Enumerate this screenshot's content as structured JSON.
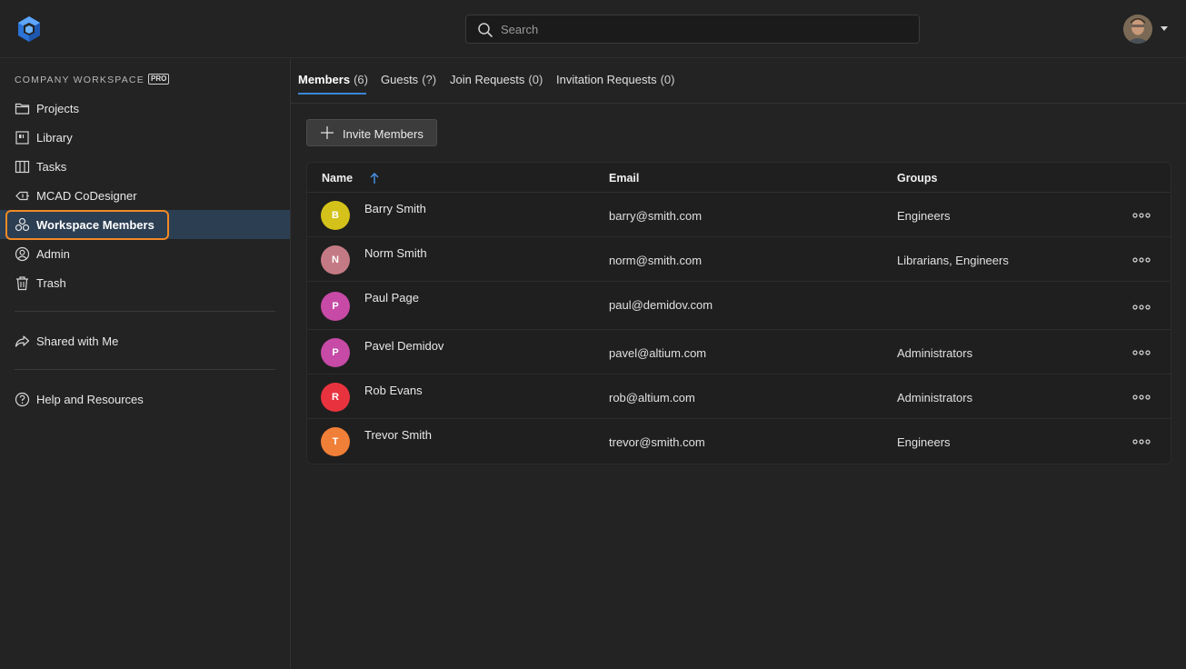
{
  "search": {
    "placeholder": "Search"
  },
  "sidebar": {
    "workspace_label": "COMPANY WORKSPACE",
    "badge": "PRO",
    "items": [
      {
        "label": "Projects",
        "icon": "folder-icon"
      },
      {
        "label": "Library",
        "icon": "library-icon"
      },
      {
        "label": "Tasks",
        "icon": "tasks-icon"
      },
      {
        "label": "MCAD CoDesigner",
        "icon": "mcad-icon"
      },
      {
        "label": "Workspace Members",
        "icon": "members-icon",
        "active": true
      },
      {
        "label": "Admin",
        "icon": "admin-icon"
      },
      {
        "label": "Trash",
        "icon": "trash-icon"
      }
    ],
    "shared": {
      "label": "Shared with Me",
      "icon": "share-icon"
    },
    "help": {
      "label": "Help and Resources",
      "icon": "help-icon"
    }
  },
  "tabs": [
    {
      "label": "Members",
      "count": "(6)",
      "active": true
    },
    {
      "label": "Guests",
      "count": "(?)"
    },
    {
      "label": "Join Requests",
      "count": "(0)"
    },
    {
      "label": "Invitation Requests",
      "count": "(0)"
    }
  ],
  "invite_button": {
    "label": "Invite Members"
  },
  "table": {
    "columns": {
      "name": "Name",
      "email": "Email",
      "groups": "Groups"
    },
    "rows": [
      {
        "initial": "B",
        "color": "#d4c21a",
        "name": "Barry Smith",
        "email": "barry@smith.com",
        "groups": "Engineers"
      },
      {
        "initial": "N",
        "color": "#c47a84",
        "name": "Norm Smith",
        "email": "norm@smith.com",
        "groups": "Librarians, Engineers"
      },
      {
        "initial": "P",
        "color": "#c64aa6",
        "name": "Paul Page",
        "email": "paul@demidov.com",
        "groups": ""
      },
      {
        "initial": "P",
        "color": "#c64aa6",
        "name": "Pavel Demidov",
        "email": "pavel@altium.com",
        "groups": "Administrators"
      },
      {
        "initial": "R",
        "color": "#e8333f",
        "name": "Rob Evans",
        "email": "rob@altium.com",
        "groups": "Administrators"
      },
      {
        "initial": "T",
        "color": "#f07f37",
        "name": "Trevor Smith",
        "email": "trevor@smith.com",
        "groups": "Engineers"
      }
    ]
  },
  "colors": {
    "accent": "#3b86d8",
    "highlight": "#f08a24",
    "active_bg": "#2c3e52"
  }
}
